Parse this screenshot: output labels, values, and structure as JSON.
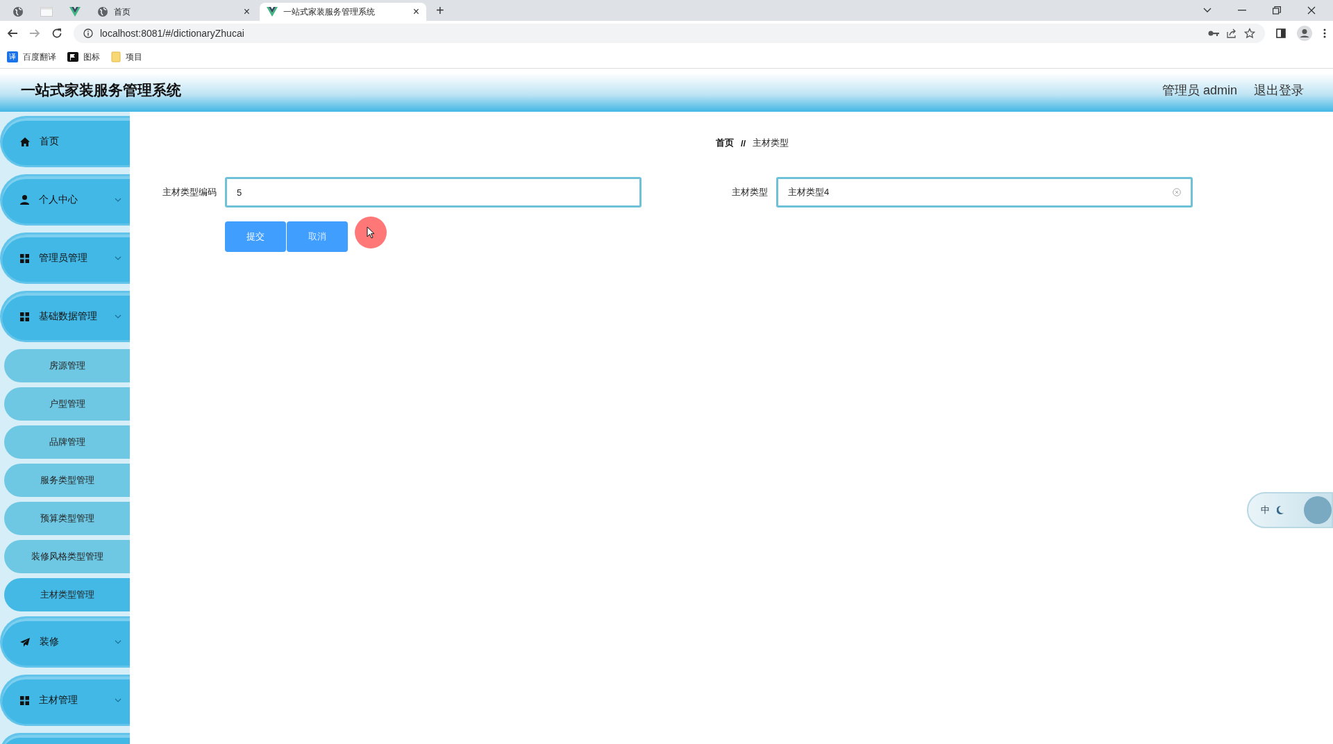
{
  "browser": {
    "tabs": [
      {
        "kind": "globe",
        "selected": false
      },
      {
        "kind": "page",
        "selected": false
      },
      {
        "kind": "vue",
        "selected": false
      },
      {
        "kind": "globe",
        "label": "首页",
        "close": "×",
        "selected": false
      },
      {
        "kind": "vue",
        "label": "一站式家装服务管理系统",
        "close": "×",
        "selected": true
      }
    ],
    "new_tab": "+",
    "address": "localhost:8081/#/dictionaryZhucai",
    "bookmarks": [
      {
        "kind": "translate",
        "mark": "译",
        "label": "百度翻译"
      },
      {
        "kind": "flag",
        "label": "图标"
      },
      {
        "kind": "folder",
        "label": "项目"
      }
    ]
  },
  "header": {
    "title": "一站式家装服务管理系统",
    "user": "管理员 admin",
    "logout": "退出登录"
  },
  "sidebar": {
    "items": [
      {
        "kind": "home",
        "label": "首页",
        "has_children": false,
        "selected": false
      },
      {
        "kind": "user",
        "label": "个人中心",
        "has_children": true,
        "selected": false
      },
      {
        "kind": "grid",
        "label": "管理员管理",
        "has_children": true,
        "selected": false
      },
      {
        "kind": "grid",
        "label": "基础数据管理",
        "has_children": true,
        "selected": false,
        "children": [
          {
            "label": "房源管理",
            "selected": false
          },
          {
            "label": "户型管理",
            "selected": false
          },
          {
            "label": "品牌管理",
            "selected": false
          },
          {
            "label": "服务类型管理",
            "selected": false
          },
          {
            "label": "预算类型管理",
            "selected": false
          },
          {
            "label": "装修风格类型管理",
            "selected": false
          },
          {
            "label": "主材类型管理",
            "selected": true
          }
        ]
      },
      {
        "kind": "plane",
        "label": "装修",
        "has_children": true,
        "selected": false
      },
      {
        "kind": "grid",
        "label": "主材管理",
        "has_children": true,
        "selected": false
      }
    ]
  },
  "breadcrumb": {
    "items": [
      "首页",
      "主材类型"
    ],
    "separator": "//"
  },
  "form": {
    "fields": [
      {
        "label": "主材类型编码",
        "value": "5",
        "clearable": false
      },
      {
        "label": "主材类型",
        "value": "主材类型4",
        "clearable": true
      }
    ],
    "buttons": [
      {
        "kind": "submit",
        "label": "提交"
      },
      {
        "kind": "cancel",
        "label": "取消"
      }
    ]
  },
  "ime_widget": {
    "label": "中"
  }
}
